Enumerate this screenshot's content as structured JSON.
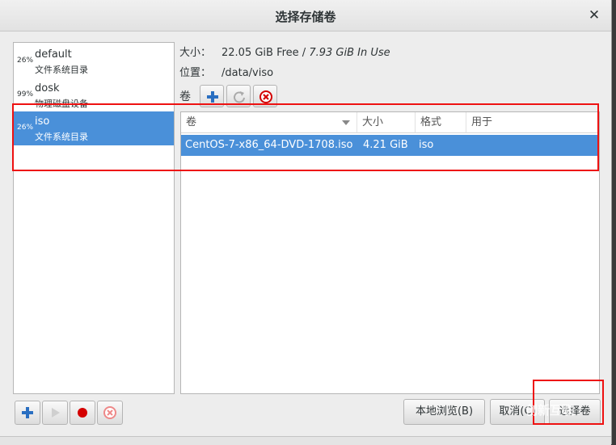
{
  "dialog": {
    "title": "选择存储卷",
    "close_glyph": "✕"
  },
  "pools": [
    {
      "percent": "26%",
      "name": "default",
      "type": "文件系统目录",
      "selected": false
    },
    {
      "percent": "99%",
      "name": "dosk",
      "type": "物理磁盘设备",
      "selected": false
    },
    {
      "percent": "26%",
      "name": "iso",
      "type": "文件系统目录",
      "selected": true
    }
  ],
  "info": {
    "size_label": "大小：",
    "size_free": "22.05 GiB Free",
    "size_sep": " / ",
    "size_in_use": "7.93 GiB In Use",
    "location_label": "位置：",
    "location_value": "/data/viso"
  },
  "volumes": {
    "label": "卷",
    "toolbar_icons": [
      "add-icon",
      "refresh-icon",
      "delete-icon"
    ],
    "columns": [
      "卷",
      "大小",
      "格式",
      "用于"
    ],
    "rows": [
      {
        "name": "CentOS-7-x86_64-DVD-1708.iso",
        "size": "4.21 GiB",
        "format": "iso",
        "used_by": "",
        "selected": true
      }
    ]
  },
  "pool_toolbar_icons": [
    "add-pool-icon",
    "start-icon",
    "stop-icon",
    "delete-pool-icon"
  ],
  "buttons": {
    "browse_local": "本地浏览(B)",
    "cancel": "取消(C)",
    "choose_volume": "选择卷"
  },
  "watermark": "创新互联",
  "colors": {
    "selection": "#4a90d9",
    "highlight_box": "#e11111",
    "stop_red": "#d40000"
  }
}
